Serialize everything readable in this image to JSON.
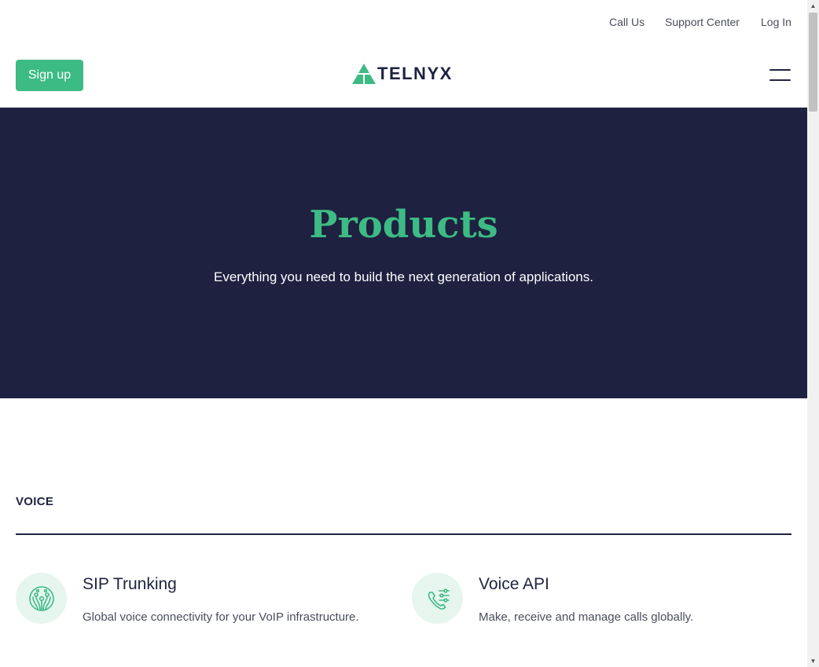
{
  "utility_nav": {
    "call_us": "Call Us",
    "support_center": "Support Center",
    "log_in": "Log In"
  },
  "header": {
    "signup_label": "Sign up",
    "logo_text": "TELNYX",
    "menu_icon": "hamburger-menu-icon"
  },
  "hero": {
    "title": "Products",
    "subtitle": "Everything you need to build the next generation of applications."
  },
  "section": {
    "label": "VOICE",
    "products": [
      {
        "title": "SIP Trunking",
        "description": "Global voice connectivity for your VoIP infrastructure.",
        "icon": "sip-trunking-icon"
      },
      {
        "title": "Voice API",
        "description": "Make, receive and manage calls globally.",
        "icon": "voice-api-icon"
      }
    ]
  },
  "colors": {
    "brand_green": "#3dbb84",
    "navy": "#1e2140",
    "icon_bg": "#e6f6ee",
    "text_dark": "#1f2340"
  }
}
